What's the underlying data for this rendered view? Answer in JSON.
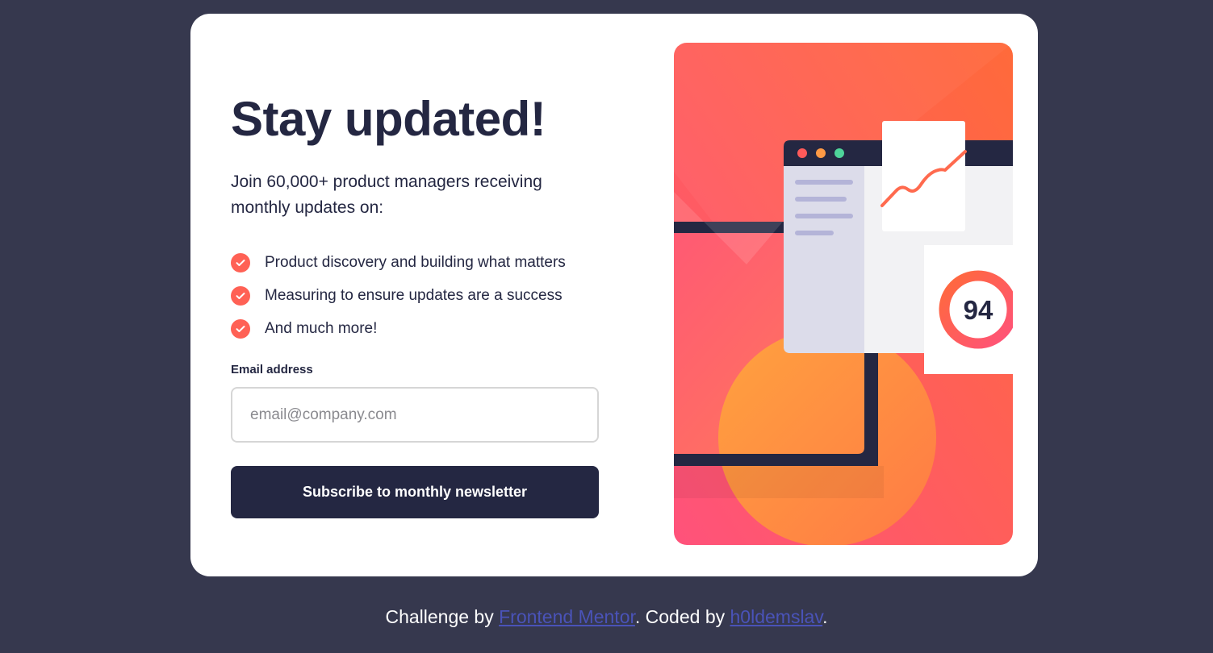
{
  "card": {
    "title": "Stay updated!",
    "intro": "Join 60,000+ product managers receiving monthly updates on:",
    "features": [
      "Product discovery and building what matters",
      "Measuring to ensure updates are a success",
      "And much more!"
    ],
    "form": {
      "email_label": "Email address",
      "email_placeholder": "email@company.com",
      "email_value": "",
      "submit_label": "Subscribe to monthly newsletter"
    }
  },
  "illustration": {
    "score": "94",
    "icons": [
      "window-dots",
      "line-chart",
      "score-ring"
    ]
  },
  "footer": {
    "prefix": "Challenge by ",
    "link1": "Frontend Mentor",
    "middle": ". Coded by ",
    "link2": "h0ldemslav",
    "suffix": "."
  },
  "colors": {
    "background": "#36384e",
    "card": "#ffffff",
    "dark_navy": "#242742",
    "tomato": "#ff6155",
    "link": "#4a53b8"
  }
}
